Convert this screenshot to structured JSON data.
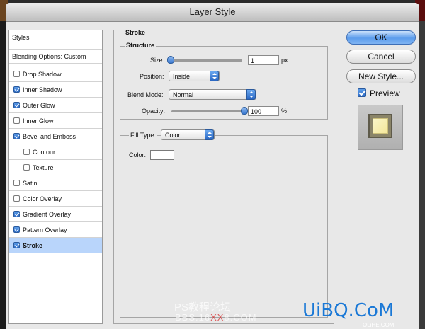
{
  "window": {
    "title": "Layer Style"
  },
  "styles_list": {
    "header": "Styles",
    "blending": "Blending Options: Custom",
    "items": [
      {
        "label": "Drop Shadow",
        "checked": false,
        "indent": false
      },
      {
        "label": "Inner Shadow",
        "checked": true,
        "indent": false
      },
      {
        "label": "Outer Glow",
        "checked": true,
        "indent": false
      },
      {
        "label": "Inner Glow",
        "checked": false,
        "indent": false
      },
      {
        "label": "Bevel and Emboss",
        "checked": true,
        "indent": false
      },
      {
        "label": "Contour",
        "checked": false,
        "indent": true
      },
      {
        "label": "Texture",
        "checked": false,
        "indent": true
      },
      {
        "label": "Satin",
        "checked": false,
        "indent": false
      },
      {
        "label": "Color Overlay",
        "checked": false,
        "indent": false
      },
      {
        "label": "Gradient Overlay",
        "checked": true,
        "indent": false
      },
      {
        "label": "Pattern Overlay",
        "checked": true,
        "indent": false
      },
      {
        "label": "Stroke",
        "checked": true,
        "indent": false,
        "selected": true
      }
    ]
  },
  "stroke": {
    "section_title": "Stroke",
    "structure_title": "Structure",
    "size_label": "Size:",
    "size_value": "1",
    "size_unit": "px",
    "position_label": "Position:",
    "position_value": "Inside",
    "blend_mode_label": "Blend Mode:",
    "blend_mode_value": "Normal",
    "opacity_label": "Opacity:",
    "opacity_value": "100",
    "opacity_unit": "%",
    "fill_type_label": "Fill Type:",
    "fill_type_value": "Color",
    "color_label": "Color:",
    "color_value": "#ffffff"
  },
  "buttons": {
    "ok": "OK",
    "cancel": "Cancel",
    "new_style": "New Style...",
    "preview_label": "Preview",
    "preview_checked": true
  },
  "watermarks": {
    "line1": "PS教程论坛",
    "line2_a": "BBS.16",
    "line2_b": "XX",
    "line2_c": "8.COM",
    "brand": "UiBQ.CoM",
    "brand_sub": "OLiHE.COM"
  },
  "colors": {
    "accent": "#5b9cec",
    "selected_row": "#b9d5fb",
    "dialog_bg": "#e8e8e8"
  }
}
